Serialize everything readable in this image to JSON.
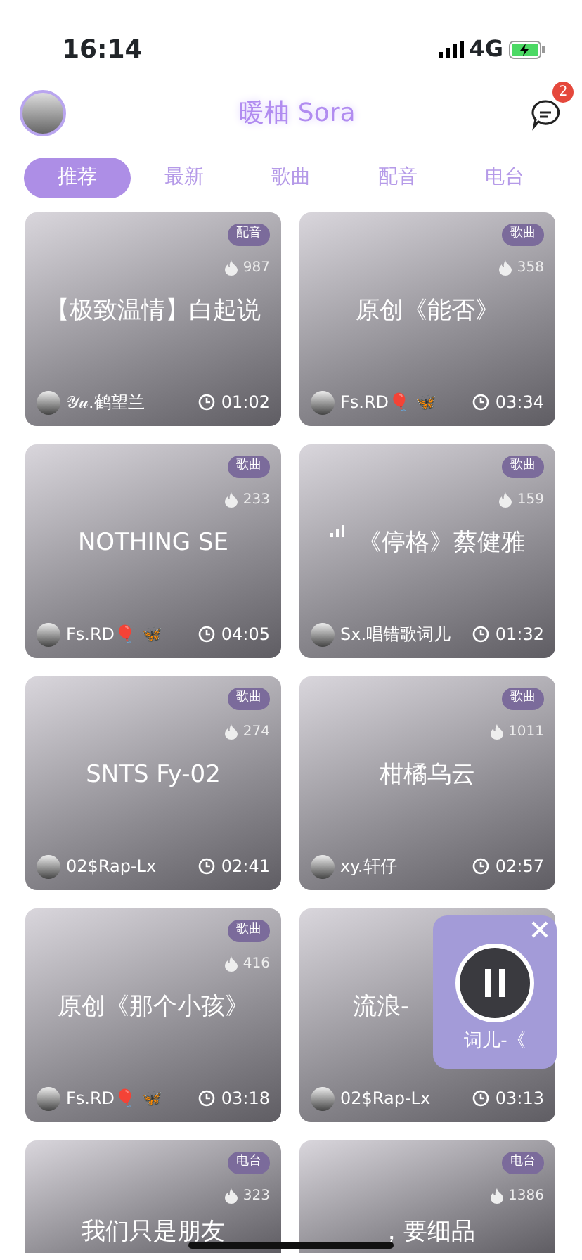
{
  "status_bar": {
    "time": "16:14",
    "network": "4G"
  },
  "header": {
    "title": "暖柚 Sora",
    "message_count": "2"
  },
  "tabs": [
    {
      "label": "推荐",
      "selected": true
    },
    {
      "label": "最新",
      "selected": false
    },
    {
      "label": "歌曲",
      "selected": false
    },
    {
      "label": "配音",
      "selected": false
    },
    {
      "label": "电台",
      "selected": false
    }
  ],
  "cards": [
    {
      "tag": "配音",
      "heat": "987",
      "title": "【极致温情】白起说",
      "playing": false,
      "author": "𝒴𝓊.鹤望兰",
      "duration": "01:02"
    },
    {
      "tag": "歌曲",
      "heat": "358",
      "title": "原创《能否》",
      "playing": false,
      "author": "Fs.RD🎈 🦋",
      "duration": "03:34"
    },
    {
      "tag": "歌曲",
      "heat": "233",
      "title": "NOTHING SE",
      "playing": false,
      "author": "Fs.RD🎈 🦋",
      "duration": "04:05"
    },
    {
      "tag": "歌曲",
      "heat": "159",
      "title": "《停格》蔡健雅",
      "playing": true,
      "author": "Sx.唱错歌词儿",
      "duration": "01:32"
    },
    {
      "tag": "歌曲",
      "heat": "274",
      "title": "SNTS Fy-02",
      "playing": false,
      "author": "02$Rap-Lx",
      "duration": "02:41"
    },
    {
      "tag": "歌曲",
      "heat": "1011",
      "title": "柑橘乌云",
      "playing": false,
      "author": "xy.轩仔",
      "duration": "02:57"
    },
    {
      "tag": "歌曲",
      "heat": "416",
      "title": "原创《那个小孩》",
      "playing": false,
      "author": "Fs.RD🎈 🦋",
      "duration": "03:18"
    },
    {
      "title": "流浪-",
      "playing": false,
      "author": "02$Rap-Lx",
      "duration": "03:13"
    },
    {
      "tag": "电台",
      "heat": "323",
      "title": "我们只是朋友",
      "playing": false
    },
    {
      "tag": "电台",
      "heat": "1386",
      "title": "，要细品",
      "playing": false
    }
  ],
  "mini_player": {
    "text": "词儿-《",
    "playing": true
  }
}
